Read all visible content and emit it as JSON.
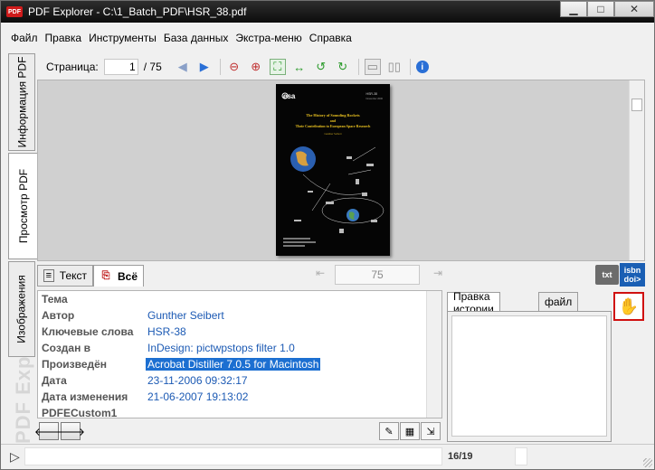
{
  "window": {
    "title": "PDF Explorer - C:\\1_Batch_PDF\\HSR_38.pdf",
    "app_icon": "PDF"
  },
  "menu": {
    "items": [
      "Файл",
      "Правка",
      "Инструменты",
      "База данных",
      "Экстра-меню",
      "Справка"
    ]
  },
  "left_tabs": {
    "info": "Информация PDF",
    "preview": "Просмотр PDF",
    "images": "Изображения",
    "brand": "PDF Exp"
  },
  "toolbar": {
    "page_label": "Страница:",
    "page_value": "1",
    "page_total": "/ 75",
    "icons": [
      "prev-page-icon",
      "next-page-icon",
      "zoom-out-icon",
      "zoom-in-icon",
      "fit-page-icon",
      "fit-width-icon",
      "rotate-left-icon",
      "rotate-right-icon",
      "single-page-icon",
      "two-page-icon",
      "info-icon"
    ]
  },
  "preview": {
    "cover": {
      "logo": "esa",
      "code": "HSR-38",
      "date": "November 2006",
      "title_line1": "The History of Sounding Rockets",
      "title_line2": "and",
      "title_line3": "Their Contribution to European Space Research",
      "author": "Gunther Seibert"
    }
  },
  "content_tabs": {
    "text": "Текст",
    "all": "Всё",
    "page_value": "75",
    "txt_badge": "txt",
    "isbn_badge_top": "isbn",
    "isbn_badge_bottom": "doi>"
  },
  "metadata": [
    {
      "key": "Тема",
      "value": ""
    },
    {
      "key": "Автор",
      "value": "Gunther Seibert"
    },
    {
      "key": "Ключевые слова",
      "value": "HSR-38"
    },
    {
      "key": "Создан в",
      "value": "InDesign: pictwpstops filter 1.0"
    },
    {
      "key": "Произведён",
      "value": "Acrobat Distiller 7.0.5 for Macintosh",
      "selected": true
    },
    {
      "key": "Дата",
      "value": "23-11-2006 09:32:17"
    },
    {
      "key": "Дата изменения",
      "value": "21-06-2007 19:13:02"
    },
    {
      "key": "PDFECustom1",
      "value": ""
    }
  ],
  "history": {
    "tab_edit": "Правка истории",
    "tab_file": "файл"
  },
  "status": {
    "count": "16/19"
  },
  "colors": {
    "link_blue": "#1c5ab4",
    "selection": "#1c6fd1",
    "highlight_red": "#d01010"
  }
}
